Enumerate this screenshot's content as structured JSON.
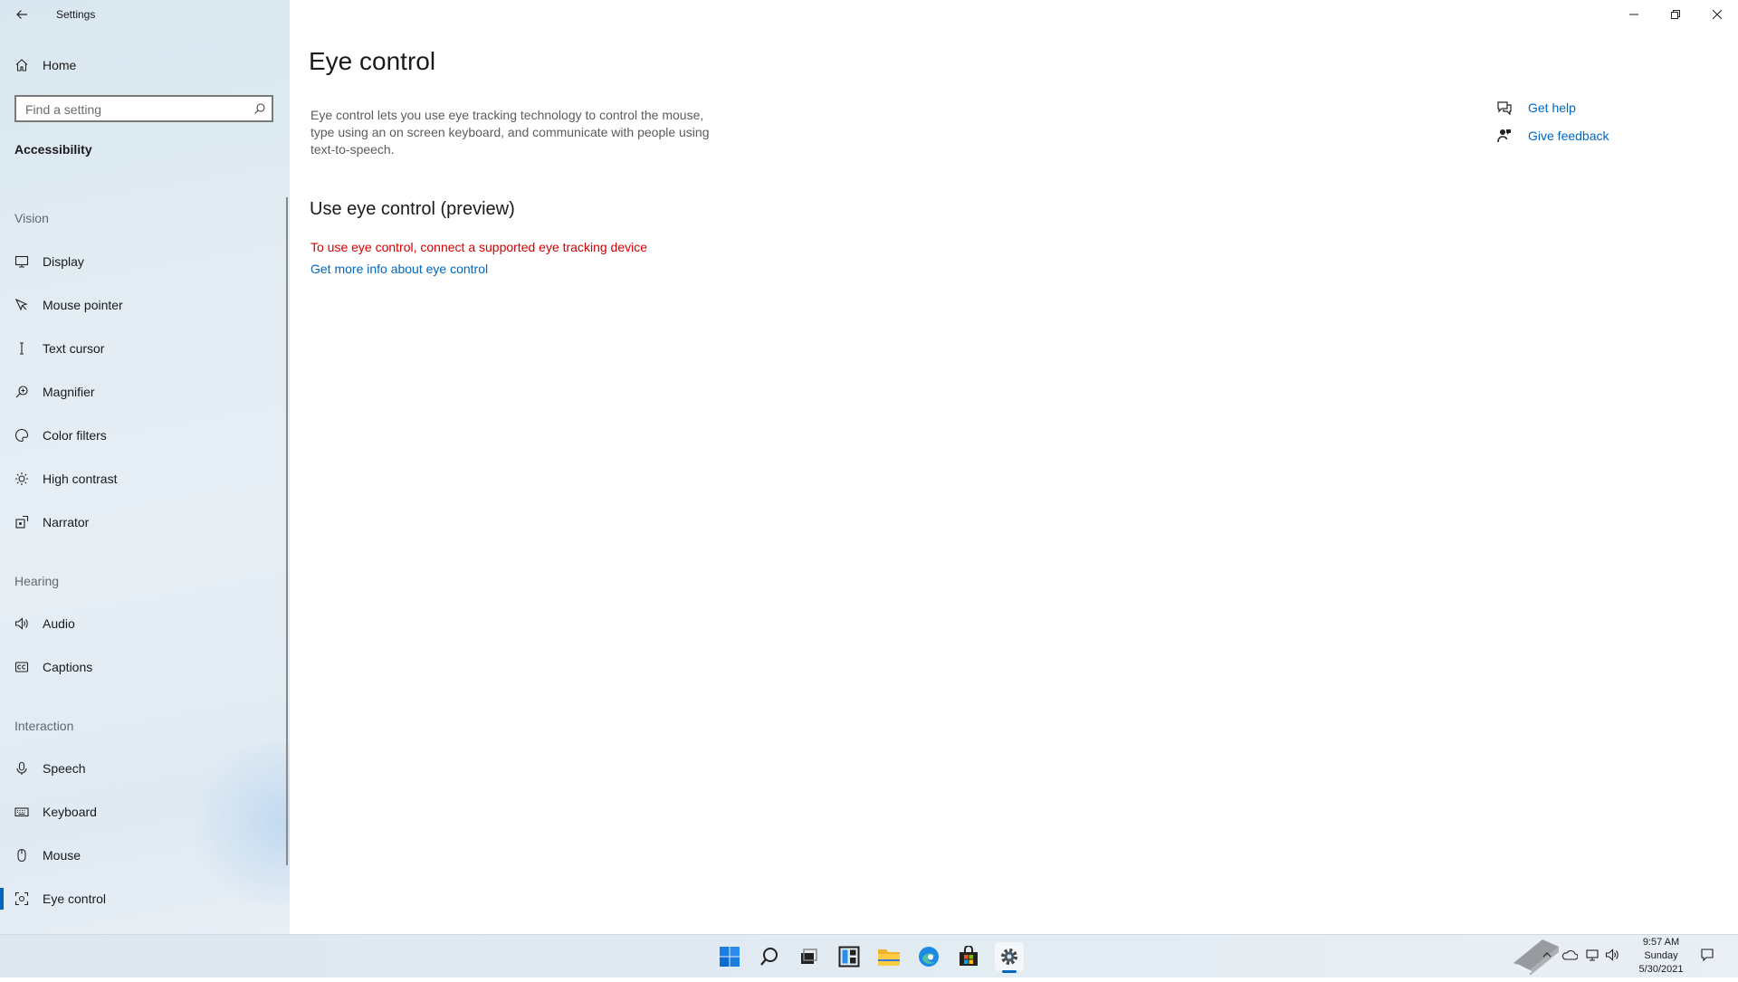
{
  "window": {
    "app_title": "Settings"
  },
  "sidebar": {
    "home_label": "Home",
    "search_placeholder": "Find a setting",
    "category_title": "Accessibility",
    "sections": [
      {
        "header": "Vision",
        "items": [
          {
            "label": "Display",
            "icon": "monitor-icon"
          },
          {
            "label": "Mouse pointer",
            "icon": "mouse-pointer-icon"
          },
          {
            "label": "Text cursor",
            "icon": "text-cursor-icon"
          },
          {
            "label": "Magnifier",
            "icon": "magnifier-icon"
          },
          {
            "label": "Color filters",
            "icon": "color-filters-icon"
          },
          {
            "label": "High contrast",
            "icon": "high-contrast-icon"
          },
          {
            "label": "Narrator",
            "icon": "narrator-icon"
          }
        ]
      },
      {
        "header": "Hearing",
        "items": [
          {
            "label": "Audio",
            "icon": "speaker-icon"
          },
          {
            "label": "Captions",
            "icon": "captions-icon"
          }
        ]
      },
      {
        "header": "Interaction",
        "items": [
          {
            "label": "Speech",
            "icon": "microphone-icon"
          },
          {
            "label": "Keyboard",
            "icon": "keyboard-icon"
          },
          {
            "label": "Mouse",
            "icon": "mouse-icon"
          },
          {
            "label": "Eye control",
            "icon": "eye-control-icon",
            "selected": true
          }
        ]
      }
    ]
  },
  "main": {
    "title": "Eye control",
    "description": "Eye control lets you use eye tracking technology to control the mouse, type using an on screen keyboard, and communicate with people using text-to-speech.",
    "section_title": "Use eye control (preview)",
    "error_text": "To use eye control, connect a supported eye tracking device",
    "more_info_link": "Get more info about eye control",
    "help_links": {
      "get_help": "Get help",
      "give_feedback": "Give feedback"
    }
  },
  "taskbar": {
    "apps": [
      "start-icon",
      "search-icon",
      "task-view-icon",
      "widgets-icon",
      "file-explorer-icon",
      "edge-icon",
      "store-icon",
      "settings-icon"
    ],
    "active_app": "settings-icon",
    "clock": {
      "time": "9:57 AM",
      "day": "Sunday",
      "date": "5/30/2021"
    }
  },
  "colors": {
    "accent": "#0067c0",
    "error": "#d40000",
    "sidebar_bg": "#e3edf3"
  }
}
